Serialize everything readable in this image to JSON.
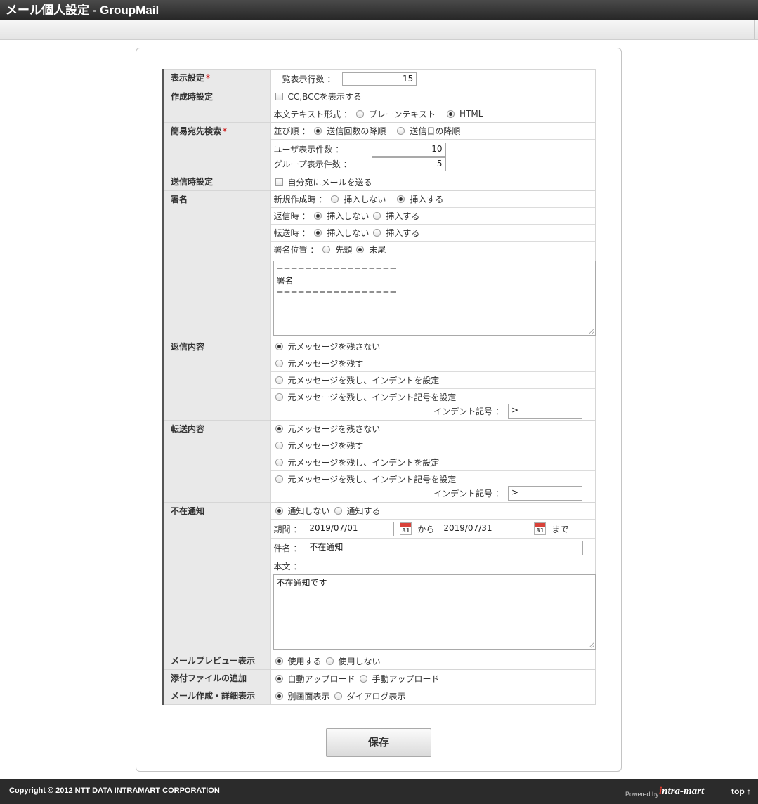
{
  "header": {
    "title": "メール個人設定 - GroupMail"
  },
  "form": {
    "display": {
      "label": "表示設定",
      "required": "*",
      "rows_label": "一覧表示行数 ：",
      "rows_value": "15"
    },
    "compose": {
      "label": "作成時設定",
      "cc_bcc": "CC,BCCを表示する",
      "body_format_label": "本文テキスト形式 ：",
      "plain": "プレーンテキスト",
      "html": "HTML"
    },
    "search": {
      "label": "簡易宛先検索",
      "required": "*",
      "order_label": "並び順 ：",
      "order_count": "送信回数の降順",
      "order_date": "送信日の降順",
      "user_count_label": "ユーザ表示件数 ：",
      "user_count": "10",
      "group_count_label": "グループ表示件数 ：",
      "group_count": "5"
    },
    "send": {
      "label": "送信時設定",
      "self_copy": "自分宛にメールを送る"
    },
    "signature": {
      "label": "署名",
      "new_label": "新規作成時 ：",
      "reply_label": "返信時 ：",
      "forward_label": "転送時 ：",
      "no_insert": "挿入しない",
      "insert": "挿入する",
      "position_label": "署名位置 ：",
      "pos_top": "先頭",
      "pos_bottom": "末尾",
      "text": "=================\n署名\n================="
    },
    "reply": {
      "label": "返信内容",
      "opt1": "元メッセージを残さない",
      "opt2": "元メッセージを残す",
      "opt3": "元メッセージを残し、インデントを設定",
      "opt4": "元メッセージを残し、インデント記号を設定",
      "indent_label": "インデント記号 ：",
      "indent_value": ">"
    },
    "forward": {
      "label": "転送内容",
      "opt1": "元メッセージを残さない",
      "opt2": "元メッセージを残す",
      "opt3": "元メッセージを残し、インデントを設定",
      "opt4": "元メッセージを残し、インデント記号を設定",
      "indent_label": "インデント記号 ：",
      "indent_value": ">"
    },
    "absence": {
      "label": "不在通知",
      "no_notify": "通知しない",
      "notify": "通知する",
      "period_label": "期間 ：",
      "start": "2019/07/01",
      "from": "から",
      "end": "2019/07/31",
      "until": "まで",
      "cal_day": "31",
      "subject_label": "件名 ：",
      "subject": "不在通知",
      "body_label": "本文 ：",
      "body": "不在通知です"
    },
    "preview": {
      "label": "メールプレビュー表示",
      "use": "使用する",
      "not_use": "使用しない"
    },
    "attach": {
      "label": "添付ファイルの追加",
      "auto": "自動アップロード",
      "manual": "手動アップロード"
    },
    "detail": {
      "label": "メール作成・詳細表示",
      "separate": "別画面表示",
      "dialog": "ダイアログ表示"
    }
  },
  "save_label": "保存",
  "footer": {
    "copyright": "Copyright © 2012 NTT DATA INTRAMART CORPORATION",
    "powered": "Powered by",
    "brand_i": "i",
    "brand_rest": "ntra-mart",
    "top": "top ↑"
  }
}
